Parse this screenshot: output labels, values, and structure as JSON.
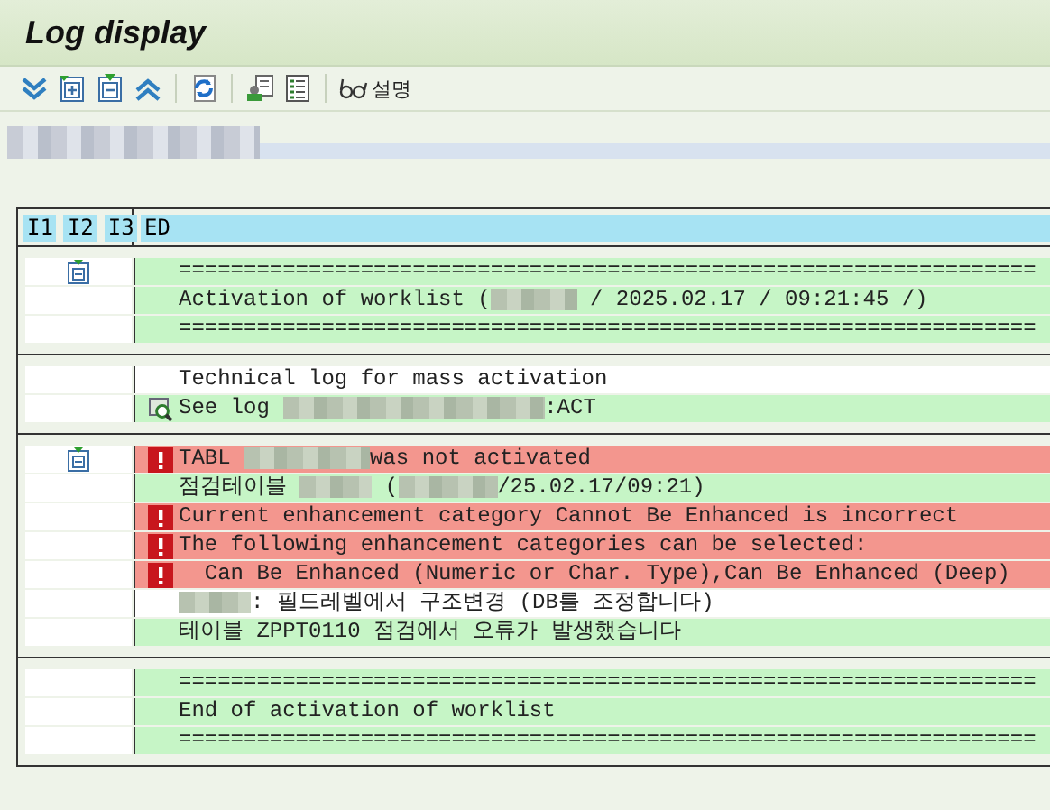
{
  "window": {
    "title": "Log display"
  },
  "toolbar": {
    "buttons": [
      {
        "kind": "expand-all"
      },
      {
        "kind": "expand"
      },
      {
        "kind": "collapse"
      },
      {
        "kind": "collapse-all"
      },
      {
        "kind": "sep"
      },
      {
        "kind": "refresh"
      },
      {
        "kind": "sep"
      },
      {
        "kind": "person"
      },
      {
        "kind": "list"
      },
      {
        "kind": "sep"
      },
      {
        "kind": "help",
        "label": "설명"
      }
    ]
  },
  "log": {
    "columns": [
      "I1",
      "I2",
      "I3",
      "ED"
    ],
    "sections": [
      {
        "node_icon": true,
        "lines": [
          {
            "kind": "ok",
            "parts": [
              {
                "kind": "text",
                "text": "=================================================================="
              }
            ]
          },
          {
            "kind": "ok",
            "parts": [
              {
                "kind": "text",
                "text": "Activation of worklist ("
              },
              {
                "kind": "redacted"
              },
              {
                "kind": "text",
                "text": " / 2025.02.17 / 09:21:45 /)"
              }
            ]
          },
          {
            "kind": "ok",
            "parts": [
              {
                "kind": "text",
                "text": "=================================================================="
              }
            ]
          }
        ]
      },
      {
        "node_icon": false,
        "lines": [
          {
            "kind": "plain",
            "parts": [
              {
                "kind": "text",
                "text": "Technical log for mass activation"
              }
            ]
          },
          {
            "kind": "link",
            "parts": [
              {
                "kind": "text",
                "text": "See log "
              },
              {
                "kind": "redacted"
              },
              {
                "kind": "text",
                "text": ":ACT"
              }
            ]
          }
        ]
      },
      {
        "node_icon": true,
        "lines": [
          {
            "kind": "error",
            "parts": [
              {
                "kind": "text",
                "text": "TABL "
              },
              {
                "kind": "redacted"
              },
              {
                "kind": "text",
                "text": "was not activated"
              }
            ]
          },
          {
            "kind": "ok",
            "parts": [
              {
                "kind": "text",
                "text": "점검테이블 "
              },
              {
                "kind": "redacted"
              },
              {
                "kind": "text",
                "text": " ("
              },
              {
                "kind": "redacted"
              },
              {
                "kind": "text",
                "text": "/25.02.17/09:21)"
              }
            ]
          },
          {
            "kind": "error",
            "parts": [
              {
                "kind": "text",
                "text": "Current enhancement category Cannot Be Enhanced is incorrect"
              }
            ]
          },
          {
            "kind": "error",
            "parts": [
              {
                "kind": "text",
                "text": "The following enhancement categories can be selected:"
              }
            ]
          },
          {
            "kind": "error",
            "parts": [
              {
                "kind": "text",
                "text": "  Can Be Enhanced (Numeric or Char. Type),Can Be Enhanced (Deep)"
              }
            ]
          },
          {
            "kind": "plain",
            "parts": [
              {
                "kind": "redacted"
              },
              {
                "kind": "text",
                "text": ": 필드레벨에서 구조변경 (DB를 조정합니다)"
              }
            ]
          },
          {
            "kind": "ok",
            "parts": [
              {
                "kind": "text",
                "text": "테이블 ZPPT0110 점검에서 오류가 발생했습니다"
              }
            ]
          }
        ]
      },
      {
        "node_icon": false,
        "lines": [
          {
            "kind": "ok",
            "parts": [
              {
                "kind": "text",
                "text": "=================================================================="
              }
            ]
          },
          {
            "kind": "ok",
            "parts": [
              {
                "kind": "text",
                "text": "End of activation of worklist"
              }
            ]
          },
          {
            "kind": "ok",
            "parts": [
              {
                "kind": "text",
                "text": "=================================================================="
              }
            ]
          }
        ]
      }
    ]
  }
}
